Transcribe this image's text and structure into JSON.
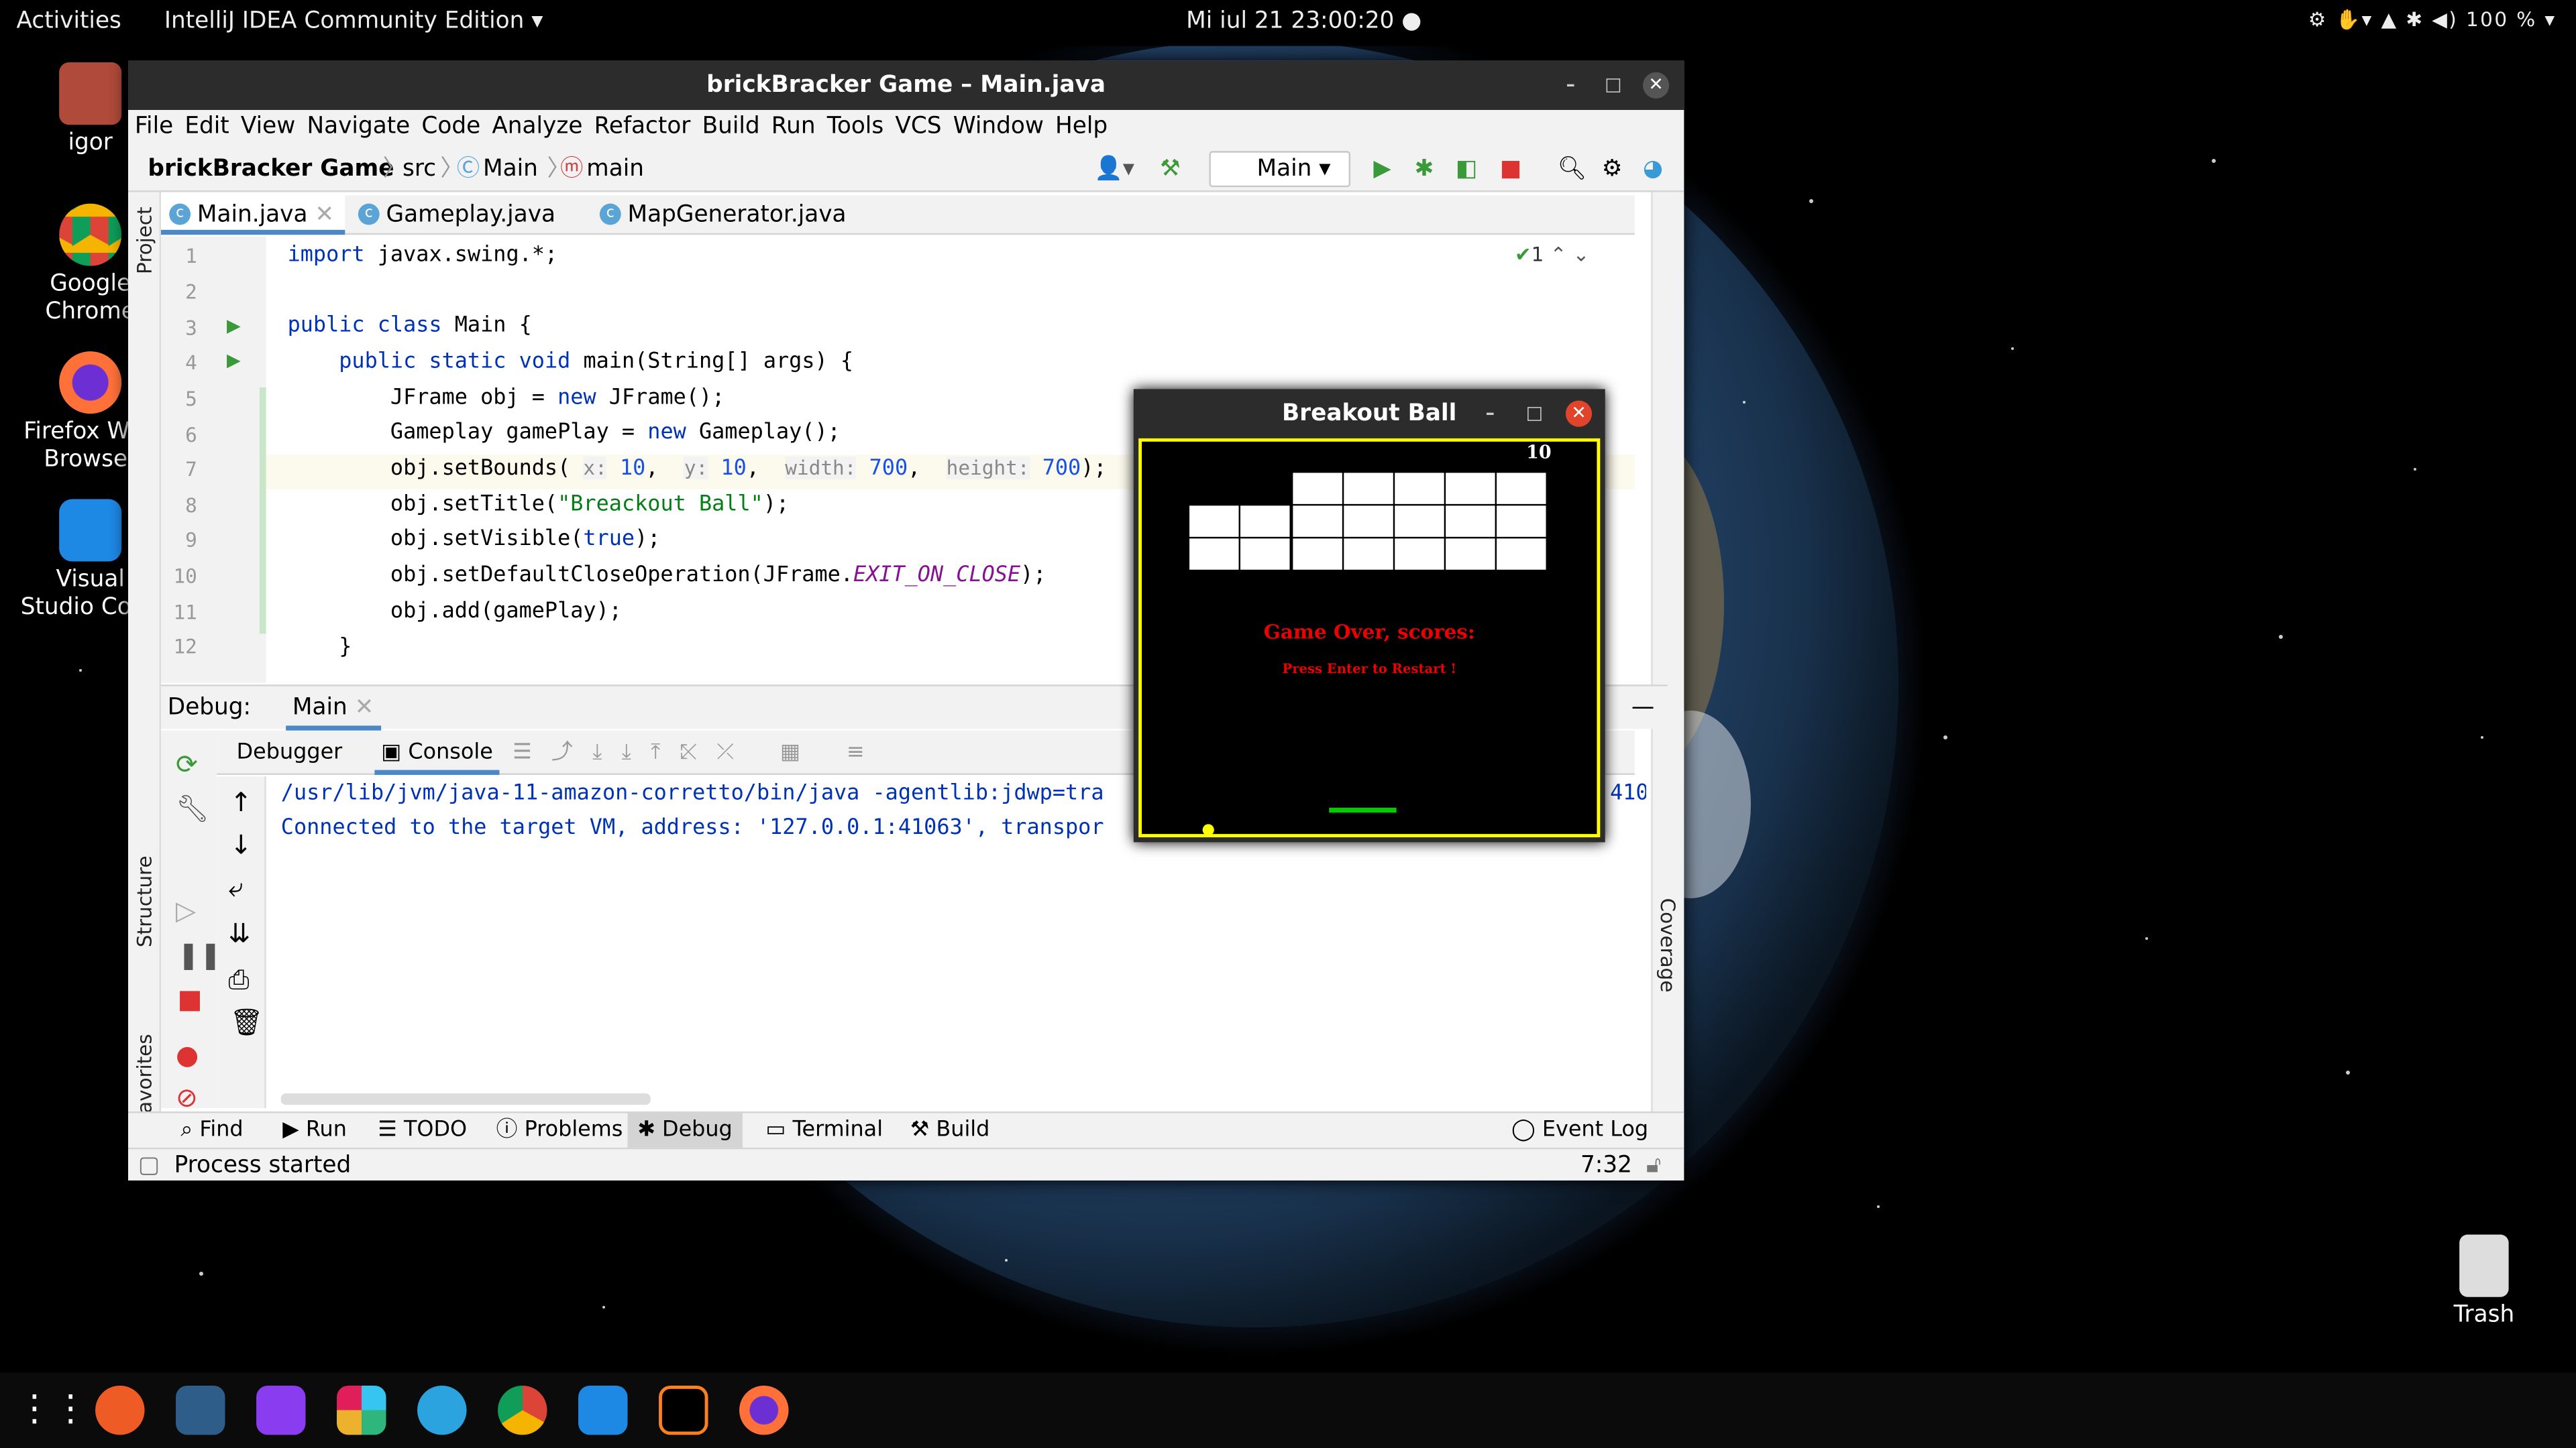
{
  "topbar": {
    "activities": "Activities",
    "app": "IntelliJ IDEA Community Edition",
    "clock": "Mi iul 21  23:00:20",
    "battery": "100 %"
  },
  "desktop": {
    "icons": [
      {
        "label": "igor"
      },
      {
        "label": "Google Chrome"
      },
      {
        "label": "Firefox Web Browser"
      },
      {
        "label": "Visual Studio Code"
      }
    ],
    "trash": "Trash"
  },
  "ide": {
    "title": "brickBracker Game – Main.java",
    "menu": [
      "File",
      "Edit",
      "View",
      "Navigate",
      "Code",
      "Analyze",
      "Refactor",
      "Build",
      "Run",
      "Tools",
      "VCS",
      "Window",
      "Help"
    ],
    "breadcrumb": {
      "project": "brickBracker Game",
      "src": "src",
      "cls": "Main",
      "method": "main"
    },
    "run_config": "Main",
    "tabs": [
      "Main.java",
      "Gameplay.java",
      "MapGenerator.java"
    ],
    "inspection_count": "1",
    "line_numbers": [
      "1",
      "2",
      "3",
      "4",
      "5",
      "6",
      "7",
      "8",
      "9",
      "10",
      "11",
      "12"
    ],
    "debug": {
      "label": "Debug:",
      "session": "Main",
      "debugger_tab": "Debugger",
      "console_tab": "Console"
    },
    "console_lines": [
      "/usr/lib/jvm/java-11-amazon-corretto/bin/java -agentlib:jdwp=tra",
      "Connected to the target VM, address: '127.0.0.1:41063', transpor"
    ],
    "console_tail": "410",
    "side": {
      "project": "Project",
      "structure": "Structure",
      "favorites": "Favorites",
      "coverage": "Coverage"
    },
    "bottom_tabs": [
      "Find",
      "Run",
      "TODO",
      "Problems",
      "Debug",
      "Terminal",
      "Build"
    ],
    "event_log": "Event Log",
    "status": "Process started",
    "cursor": "7:32"
  },
  "game": {
    "title": "Breakout Ball",
    "score": "10",
    "game_over": "Game Over, scores:",
    "restart": "Press Enter to Restart !"
  }
}
